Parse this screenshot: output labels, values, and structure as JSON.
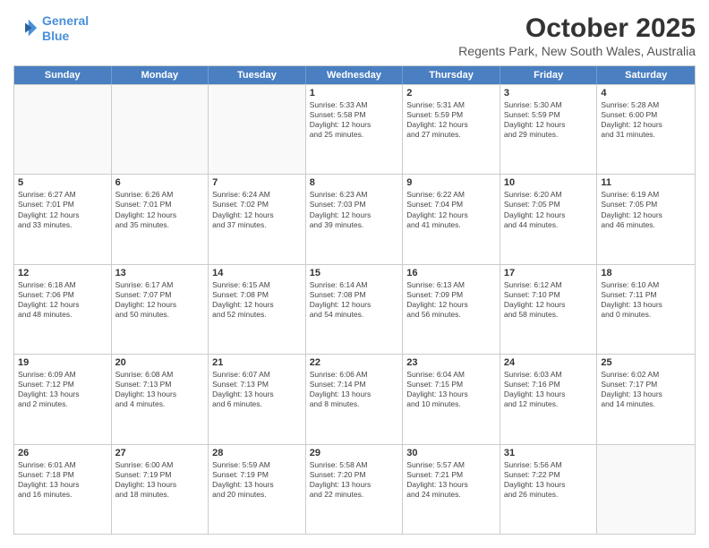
{
  "header": {
    "logo_line1": "General",
    "logo_line2": "Blue",
    "title": "October 2025",
    "subtitle": "Regents Park, New South Wales, Australia"
  },
  "weekdays": [
    "Sunday",
    "Monday",
    "Tuesday",
    "Wednesday",
    "Thursday",
    "Friday",
    "Saturday"
  ],
  "rows": [
    [
      {
        "day": "",
        "info": ""
      },
      {
        "day": "",
        "info": ""
      },
      {
        "day": "",
        "info": ""
      },
      {
        "day": "1",
        "info": "Sunrise: 5:33 AM\nSunset: 5:58 PM\nDaylight: 12 hours\nand 25 minutes."
      },
      {
        "day": "2",
        "info": "Sunrise: 5:31 AM\nSunset: 5:59 PM\nDaylight: 12 hours\nand 27 minutes."
      },
      {
        "day": "3",
        "info": "Sunrise: 5:30 AM\nSunset: 5:59 PM\nDaylight: 12 hours\nand 29 minutes."
      },
      {
        "day": "4",
        "info": "Sunrise: 5:28 AM\nSunset: 6:00 PM\nDaylight: 12 hours\nand 31 minutes."
      }
    ],
    [
      {
        "day": "5",
        "info": "Sunrise: 6:27 AM\nSunset: 7:01 PM\nDaylight: 12 hours\nand 33 minutes."
      },
      {
        "day": "6",
        "info": "Sunrise: 6:26 AM\nSunset: 7:01 PM\nDaylight: 12 hours\nand 35 minutes."
      },
      {
        "day": "7",
        "info": "Sunrise: 6:24 AM\nSunset: 7:02 PM\nDaylight: 12 hours\nand 37 minutes."
      },
      {
        "day": "8",
        "info": "Sunrise: 6:23 AM\nSunset: 7:03 PM\nDaylight: 12 hours\nand 39 minutes."
      },
      {
        "day": "9",
        "info": "Sunrise: 6:22 AM\nSunset: 7:04 PM\nDaylight: 12 hours\nand 41 minutes."
      },
      {
        "day": "10",
        "info": "Sunrise: 6:20 AM\nSunset: 7:05 PM\nDaylight: 12 hours\nand 44 minutes."
      },
      {
        "day": "11",
        "info": "Sunrise: 6:19 AM\nSunset: 7:05 PM\nDaylight: 12 hours\nand 46 minutes."
      }
    ],
    [
      {
        "day": "12",
        "info": "Sunrise: 6:18 AM\nSunset: 7:06 PM\nDaylight: 12 hours\nand 48 minutes."
      },
      {
        "day": "13",
        "info": "Sunrise: 6:17 AM\nSunset: 7:07 PM\nDaylight: 12 hours\nand 50 minutes."
      },
      {
        "day": "14",
        "info": "Sunrise: 6:15 AM\nSunset: 7:08 PM\nDaylight: 12 hours\nand 52 minutes."
      },
      {
        "day": "15",
        "info": "Sunrise: 6:14 AM\nSunset: 7:08 PM\nDaylight: 12 hours\nand 54 minutes."
      },
      {
        "day": "16",
        "info": "Sunrise: 6:13 AM\nSunset: 7:09 PM\nDaylight: 12 hours\nand 56 minutes."
      },
      {
        "day": "17",
        "info": "Sunrise: 6:12 AM\nSunset: 7:10 PM\nDaylight: 12 hours\nand 58 minutes."
      },
      {
        "day": "18",
        "info": "Sunrise: 6:10 AM\nSunset: 7:11 PM\nDaylight: 13 hours\nand 0 minutes."
      }
    ],
    [
      {
        "day": "19",
        "info": "Sunrise: 6:09 AM\nSunset: 7:12 PM\nDaylight: 13 hours\nand 2 minutes."
      },
      {
        "day": "20",
        "info": "Sunrise: 6:08 AM\nSunset: 7:13 PM\nDaylight: 13 hours\nand 4 minutes."
      },
      {
        "day": "21",
        "info": "Sunrise: 6:07 AM\nSunset: 7:13 PM\nDaylight: 13 hours\nand 6 minutes."
      },
      {
        "day": "22",
        "info": "Sunrise: 6:06 AM\nSunset: 7:14 PM\nDaylight: 13 hours\nand 8 minutes."
      },
      {
        "day": "23",
        "info": "Sunrise: 6:04 AM\nSunset: 7:15 PM\nDaylight: 13 hours\nand 10 minutes."
      },
      {
        "day": "24",
        "info": "Sunrise: 6:03 AM\nSunset: 7:16 PM\nDaylight: 13 hours\nand 12 minutes."
      },
      {
        "day": "25",
        "info": "Sunrise: 6:02 AM\nSunset: 7:17 PM\nDaylight: 13 hours\nand 14 minutes."
      }
    ],
    [
      {
        "day": "26",
        "info": "Sunrise: 6:01 AM\nSunset: 7:18 PM\nDaylight: 13 hours\nand 16 minutes."
      },
      {
        "day": "27",
        "info": "Sunrise: 6:00 AM\nSunset: 7:19 PM\nDaylight: 13 hours\nand 18 minutes."
      },
      {
        "day": "28",
        "info": "Sunrise: 5:59 AM\nSunset: 7:19 PM\nDaylight: 13 hours\nand 20 minutes."
      },
      {
        "day": "29",
        "info": "Sunrise: 5:58 AM\nSunset: 7:20 PM\nDaylight: 13 hours\nand 22 minutes."
      },
      {
        "day": "30",
        "info": "Sunrise: 5:57 AM\nSunset: 7:21 PM\nDaylight: 13 hours\nand 24 minutes."
      },
      {
        "day": "31",
        "info": "Sunrise: 5:56 AM\nSunset: 7:22 PM\nDaylight: 13 hours\nand 26 minutes."
      },
      {
        "day": "",
        "info": ""
      }
    ]
  ]
}
